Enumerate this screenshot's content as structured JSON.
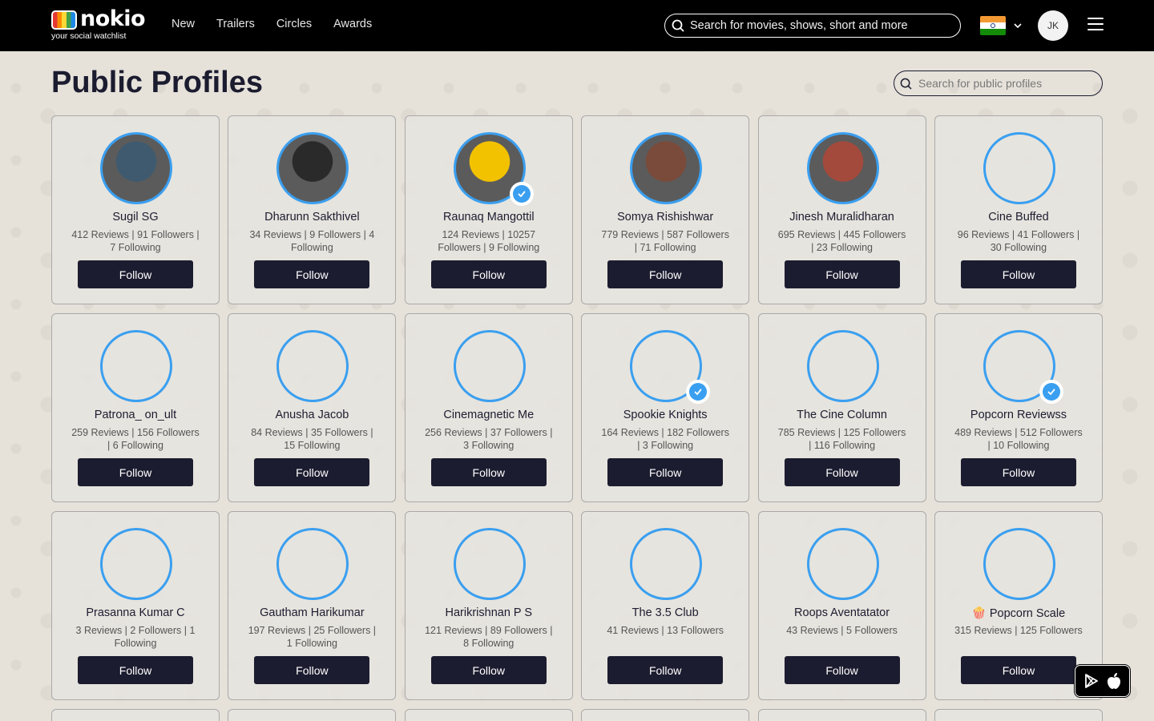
{
  "brand": {
    "name": "nokio",
    "tagline": "your social watchlist"
  },
  "nav": [
    {
      "label": "New"
    },
    {
      "label": "Trailers"
    },
    {
      "label": "Circles"
    },
    {
      "label": "Awards"
    }
  ],
  "header": {
    "search_placeholder": "Search for movies, shows, short and more",
    "user_initials": "JK",
    "country_flag": "India"
  },
  "page": {
    "title": "Public Profiles",
    "search_placeholder": "Search for public profiles"
  },
  "follow_label": "Follow",
  "profiles": [
    {
      "name": "Sugil SG",
      "stats": "412 Reviews | 91 Followers | 7 Following",
      "has_photo": true,
      "photo_color": "#3f5a6e",
      "verified": false
    },
    {
      "name": "Dharunn Sakthivel",
      "stats": "34 Reviews | 9 Followers | 4 Following",
      "has_photo": true,
      "photo_color": "#2a2a2a",
      "verified": false
    },
    {
      "name": "Raunaq Mangottil",
      "stats": "124 Reviews | 10257 Followers | 9 Following",
      "has_photo": true,
      "photo_color": "#f2c200",
      "verified": true
    },
    {
      "name": "Somya Rishishwar",
      "stats": "779 Reviews | 587 Followers | 71 Following",
      "has_photo": true,
      "photo_color": "#7a4a3a",
      "verified": false
    },
    {
      "name": "Jinesh Muralidharan",
      "stats": "695 Reviews | 445 Followers | 23 Following",
      "has_photo": true,
      "photo_color": "#a34a3c",
      "verified": false
    },
    {
      "name": "Cine Buffed",
      "stats": "96 Reviews | 41 Followers | 30 Following",
      "has_photo": false,
      "verified": false
    },
    {
      "name": "Patrona_ on_ult",
      "stats": "259 Reviews | 156 Followers | 6 Following",
      "has_photo": false,
      "verified": false
    },
    {
      "name": "Anusha Jacob",
      "stats": "84 Reviews | 35 Followers | 15 Following",
      "has_photo": false,
      "verified": false
    },
    {
      "name": "Cinemagnetic Me",
      "stats": "256 Reviews | 37 Followers | 3 Following",
      "has_photo": false,
      "verified": false
    },
    {
      "name": "Spookie Knights",
      "stats": "164 Reviews | 182 Followers | 3 Following",
      "has_photo": false,
      "verified": true
    },
    {
      "name": "The Cine Column",
      "stats": "785 Reviews | 125 Followers | 116 Following",
      "has_photo": false,
      "verified": false
    },
    {
      "name": "Popcorn Reviewss",
      "stats": "489 Reviews | 512 Followers | 10 Following",
      "has_photo": false,
      "verified": true
    },
    {
      "name": "Prasanna Kumar C",
      "stats": "3 Reviews | 2 Followers | 1 Following",
      "has_photo": false,
      "verified": false
    },
    {
      "name": "Gautham Harikumar",
      "stats": "197 Reviews | 25 Followers | 1 Following",
      "has_photo": false,
      "verified": false
    },
    {
      "name": "Harikrishnan P S",
      "stats": "121 Reviews | 89 Followers | 8 Following",
      "has_photo": false,
      "verified": false
    },
    {
      "name": "The 3.5 Club",
      "stats": "41 Reviews | 13 Followers",
      "has_photo": false,
      "verified": false
    },
    {
      "name": "Roops Aventatator",
      "stats": "43 Reviews | 5 Followers",
      "has_photo": false,
      "verified": false
    },
    {
      "name": "🍿 Popcorn Scale",
      "stats": "315 Reviews | 125 Followers",
      "has_photo": false,
      "verified": false
    }
  ],
  "colors": {
    "accent": "#3a9ff0",
    "button": "#1c1c30",
    "header_bg": "#000000"
  }
}
